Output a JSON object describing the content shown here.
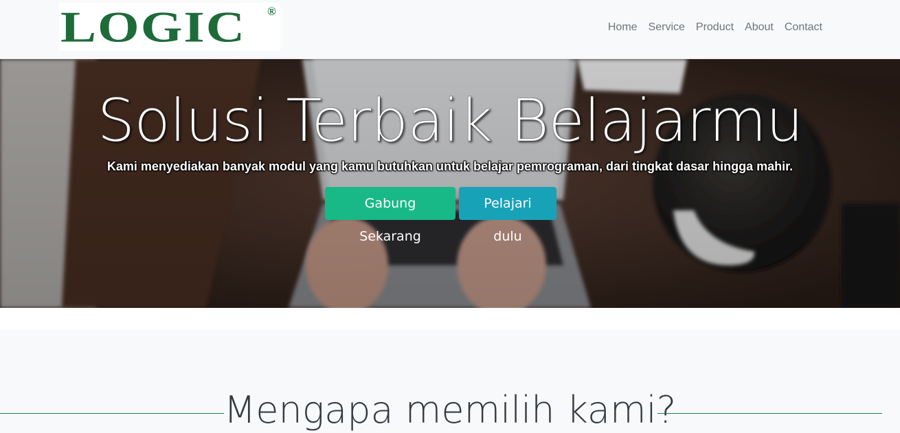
{
  "brand": {
    "logo_text": "LOGIC",
    "registered_mark": "®",
    "logo_color": "#1e6b3a"
  },
  "nav": {
    "items": [
      {
        "label": "Home"
      },
      {
        "label": "Service"
      },
      {
        "label": "Product"
      },
      {
        "label": "About"
      },
      {
        "label": "Contact"
      }
    ]
  },
  "hero": {
    "title": "Solusi Terbaik Belajarmu",
    "subtitle": "Kami menyediakan banyak modul yang kamu butuhkan untuk belajar pemrograman, dari tingkat dasar hingga mahir.",
    "primary_button": "Gabung Sekarang",
    "secondary_button": "Pelajari dulu"
  },
  "features": {
    "title": "Mengapa memilih kami?"
  },
  "colors": {
    "accent_green": "#18b986",
    "accent_teal": "#18a2b8",
    "divider": "#1f7a56"
  }
}
